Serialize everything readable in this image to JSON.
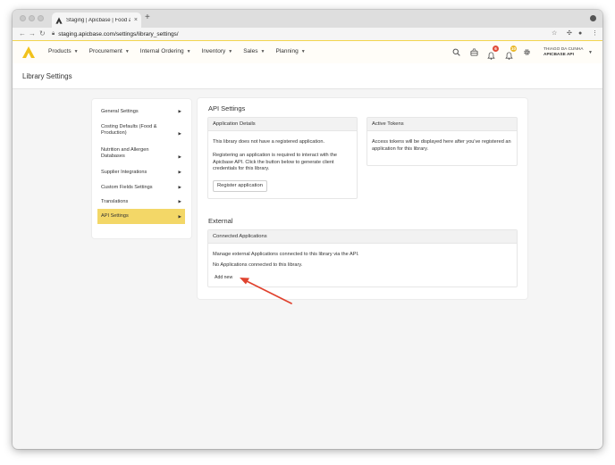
{
  "browser": {
    "tab_title": "Staging | Apicbase | Food and",
    "new_tab": "+",
    "tab_close": "×",
    "url_host": "staging.apicbase.com",
    "url_path": "/settings/library_settings/"
  },
  "nav": {
    "items": [
      {
        "label": "Products"
      },
      {
        "label": "Procurement"
      },
      {
        "label": "Internal Ordering"
      },
      {
        "label": "Inventory"
      },
      {
        "label": "Sales"
      },
      {
        "label": "Planning"
      }
    ],
    "badges": {
      "notifications": "6",
      "tasks": "10"
    },
    "user_name": "THIAGO DA CUNHA",
    "user_org": "APICBASE API",
    "colors": {
      "accent": "#f3d54e",
      "active": "#f3d767",
      "badge_red": "#e14d3a",
      "badge_yellow": "#e9b92c",
      "arrow": "#e0432f"
    }
  },
  "page": {
    "title": "Library Settings"
  },
  "sidebar": {
    "items": [
      {
        "label": "General Settings"
      },
      {
        "label": "Costing Defaults (Food & Production)"
      },
      {
        "label": "Nutrition and Allergen Databases"
      },
      {
        "label": "Supplier Integrations"
      },
      {
        "label": "Custom Fields Settings"
      },
      {
        "label": "Translations"
      },
      {
        "label": "API Settings"
      }
    ],
    "active": "API Settings"
  },
  "api_settings": {
    "title": "API Settings",
    "application_details": {
      "header": "Application Details",
      "text1": "This library does not have a registered application.",
      "text2": "Registering an application is required to interact with the Apicbase API. Click the button below to generate client credentials for this library.",
      "button": "Register application"
    },
    "active_tokens": {
      "header": "Active Tokens",
      "text": "Access tokens will be displayed here after you've registered an application for this library."
    }
  },
  "external": {
    "title": "External",
    "connected": {
      "header": "Connected Applications",
      "text1": "Manage external Applications connected to this library via the API.",
      "text2": "No Applications connected to this library.",
      "add_new": "Add new"
    }
  }
}
